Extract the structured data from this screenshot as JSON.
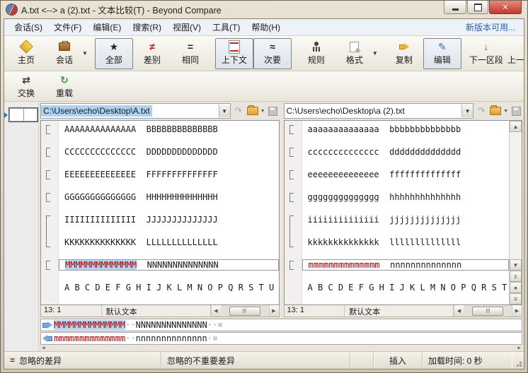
{
  "window": {
    "title": "A.txt <--> a (2).txt - 文本比较(T) - Beyond Compare"
  },
  "menu": {
    "items": [
      {
        "label": "会话(S)"
      },
      {
        "label": "文件(F)"
      },
      {
        "label": "编辑(E)"
      },
      {
        "label": "搜索(R)"
      },
      {
        "label": "视图(V)"
      },
      {
        "label": "工具(T)"
      },
      {
        "label": "帮助(H)"
      }
    ],
    "update_link": "新版本可用..."
  },
  "toolbar": {
    "items": [
      {
        "label": "主页"
      },
      {
        "label": "会话"
      },
      {
        "label": "全部"
      },
      {
        "label": "差别"
      },
      {
        "label": "相同"
      },
      {
        "label": "上下文"
      },
      {
        "label": "次要"
      },
      {
        "label": "规则"
      },
      {
        "label": "格式"
      },
      {
        "label": "复制"
      },
      {
        "label": "编辑"
      },
      {
        "label": "下一区段"
      },
      {
        "label": "上一部分"
      }
    ],
    "row2": [
      {
        "label": "交换"
      },
      {
        "label": "重载"
      }
    ]
  },
  "paths": {
    "left": "C:\\Users\\echo\\Desktop\\A.txt",
    "right": "C:\\Users\\echo\\Desktop\\a (2).txt"
  },
  "editor": {
    "left": {
      "lines": [
        "AAAAAAAAAAAAAA  BBBBBBBBBBBBBB",
        "CCCCCCCCCCCCCC  DDDDDDDDDDDDDD",
        "EEEEEEEEEEEEEE  FFFFFFFFFFFFFF",
        "GGGGGGGGGGGGGG  HHHHHHHHHHHHHH",
        "IIIIIIIIIIIIII  JJJJJJJJJJJJJJ",
        "KKKKKKKKKKKKKK  LLLLLLLLLLLLLL"
      ],
      "current": {
        "selected": "MMMMMMMMMMMMMM",
        "rest": "  NNNNNNNNNNNNNN"
      },
      "alphabet": "A B C D E F G H I J K L M N O P Q R S T U V W X Y Z"
    },
    "right": {
      "lines": [
        "aaaaaaaaaaaaaa  bbbbbbbbbbbbbb",
        "cccccccccccccc  dddddddddddddd",
        "eeeeeeeeeeeeee  ffffffffffffff",
        "gggggggggggggg  hhhhhhhhhhhhhh",
        "iiiiiiiiiiiiii  jjjjjjjjjjjjjj",
        "kkkkkkkkkkkkkk  llllllllllllll"
      ],
      "current": {
        "selected": "mmmmmmmmmmmmmm",
        "rest": "  nnnnnnnnnnnnnn"
      },
      "alphabet": "A B C D E F G H I J K L M N O P Q R S T U V W X Y Z"
    }
  },
  "footer": {
    "position": "13: 1",
    "syntax": "默认文本"
  },
  "detail": {
    "row1": {
      "selected": "MMMMMMMMMMMMMM",
      "ws1": "··",
      "rest": "NNNNNNNNNNNNNN",
      "ws2": "··",
      "eol": "¤"
    },
    "row2": {
      "diff": "mmmmmmmmmmmmmm",
      "ws1": "··",
      "rest": "nnnnnnnnnnnnnn",
      "ws2": "·",
      "eol": "¤"
    }
  },
  "statusbar": {
    "ignored_diff": "忽略的差异",
    "ignored_unimportant": "忽略的不重要差异",
    "insert_mode": "插入",
    "load_time": "加载时间: 0 秒"
  }
}
